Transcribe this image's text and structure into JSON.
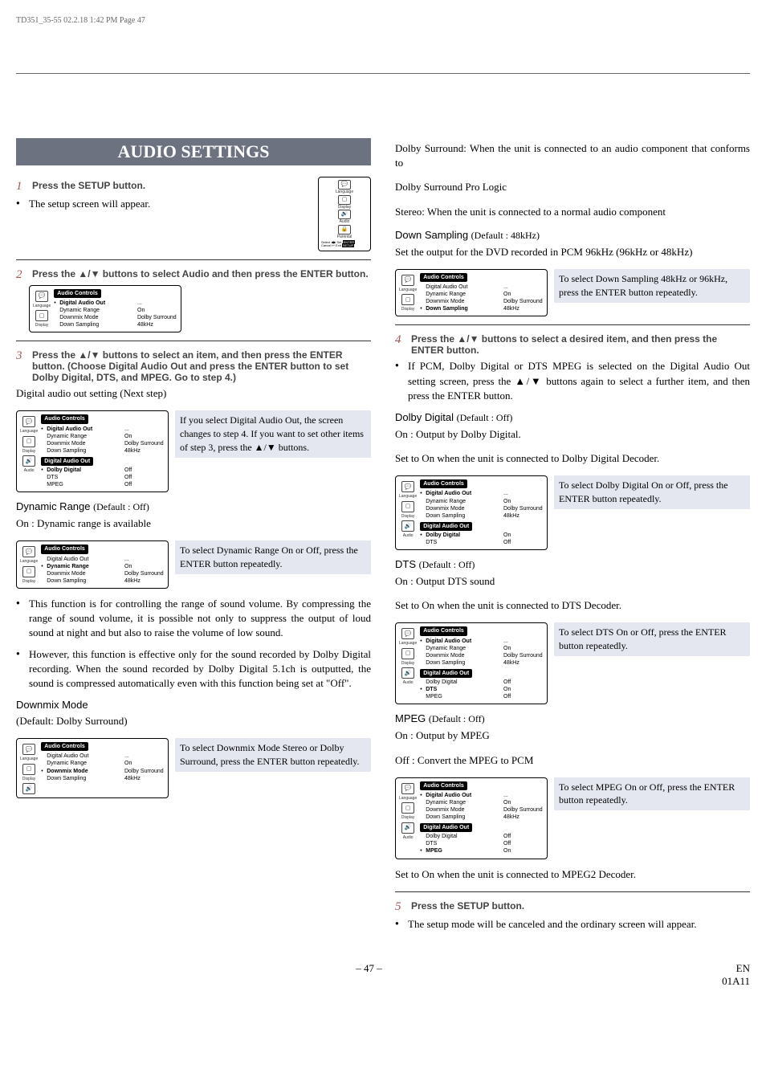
{
  "page_header": "TD351_35-55  02.2.18  1:42 PM  Page 47",
  "title": "AUDIO SETTINGS",
  "left": {
    "step1": {
      "num": "1",
      "text": "Press the SETUP button."
    },
    "step1_note": "The setup screen will appear.",
    "step2": {
      "num": "2",
      "text": "Press the ▲/▼ buttons to select Audio and then press the ENTER button."
    },
    "step3": {
      "num": "3",
      "text": "Press the ▲/▼ buttons to select an item, and then press the ENTER button. (Choose Digital Audio Out and press the ENTER button to set Dolby Digital, DTS, and MPEG. Go to step 4.)"
    },
    "digital_audio_head": "Digital audio out setting (Next step)",
    "digital_audio_caption": "If you select Digital Audio Out, the screen changes to step 4. If you want to set other items of step 3, press the ▲/▼ buttons.",
    "dynamic_head": "Dynamic Range",
    "dynamic_default": "(Default : Off)",
    "dynamic_sub": "On : Dynamic range is available",
    "dynamic_caption": "To select Dynamic Range On or Off, press the ENTER button repeatedly.",
    "dynamic_bul1": "This function is for controlling the range of sound volume. By compressing the range of sound volume, it is possible not only to suppress the output of loud sound at night and but also to raise the volume of low sound.",
    "dynamic_bul2": "However, this function is effective only for the sound recorded by Dolby Digital recording. When the sound recorded by Dolby Digital 5.1ch is outputted, the sound is compressed automatically even with this function being set at \"Off\".",
    "downmix_head": "Downmix Mode",
    "downmix_default": "(Default: Dolby Surround)",
    "downmix_caption": "To select Downmix Mode Stereo or Dolby Surround, press the ENTER button repeatedly."
  },
  "right": {
    "intro1": "Dolby Surround: When the unit is connected to an audio component that conforms to",
    "intro2": "Dolby Surround Pro Logic",
    "intro3": "Stereo: When the unit is connected to a normal audio component",
    "downsamp_head": "Down Sampling",
    "downsamp_default": "(Default : 48kHz)",
    "downsamp_text": "Set the output for the DVD recorded in PCM 96kHz (96kHz or 48kHz)",
    "downsamp_caption": "To select Down Sampling 48kHz or 96kHz, press the ENTER button repeatedly.",
    "step4": {
      "num": "4",
      "text": "Press the ▲/▼ buttons to select a desired item, and then press the ENTER button."
    },
    "step4_note": "If PCM, Dolby Digital or DTS MPEG is selected on the Digital Audio Out setting screen, press the ▲/▼ buttons again to select a further item, and then press the ENTER button.",
    "dolby_head": "Dolby Digital",
    "dolby_default": "(Default : Off)",
    "dolby_on": "On : Output by Dolby Digital.",
    "dolby_text": "Set to On when the unit is connected to Dolby Digital Decoder.",
    "dolby_caption": "To select Dolby Digital On or Off, press the ENTER button repeatedly.",
    "dts_head": "DTS",
    "dts_default": "(Default : Off)",
    "dts_on": "On : Output DTS sound",
    "dts_text": "Set to On when the unit is connected to DTS Decoder.",
    "dts_caption": "To select DTS On or Off, press the ENTER button repeatedly.",
    "mpeg_head": "MPEG",
    "mpeg_default": "(Default : Off)",
    "mpeg_on": "On : Output by MPEG",
    "mpeg_off": "Off : Convert the MPEG to PCM",
    "mpeg_caption": "To select MPEG On or Off, press the ENTER button repeatedly.",
    "mpeg_text": "Set to On when the unit is connected to MPEG2 Decoder.",
    "step5": {
      "num": "5",
      "text": "Press the SETUP button."
    },
    "step5_note": "The setup mode will be canceled and the ordinary screen will appear."
  },
  "menu": {
    "title": "Audio Controls",
    "dao_title": "Digital Audio Out",
    "rows": {
      "dao": {
        "label": "Digital Audio Out",
        "val": "..."
      },
      "dr": {
        "label": "Dynamic Range",
        "val": "On"
      },
      "dm": {
        "label": "Downmix Mode",
        "val": "Dolby Surround"
      },
      "ds": {
        "label": "Down Sampling",
        "val": "48kHz"
      },
      "dd_off": {
        "label": "Dolby Digital",
        "val": "Off"
      },
      "dd_on": {
        "label": "Dolby Digital",
        "val": "On"
      },
      "dts_off": {
        "label": "DTS",
        "val": "Off"
      },
      "dts_on": {
        "label": "DTS",
        "val": "On"
      },
      "mpeg_off": {
        "label": "MPEG",
        "val": "Off"
      },
      "mpeg_on": {
        "label": "MPEG",
        "val": "On"
      }
    },
    "side": {
      "language": "Language",
      "display": "Display",
      "audio": "Audio",
      "parental": "Parental"
    },
    "setupfoot": {
      "select": "Select",
      "set": "Set",
      "cancel": "Cancel",
      "exit": "Exit",
      "enter": "ENTER",
      "setup": "SETUP"
    }
  },
  "footer": {
    "page": "– 47 –",
    "code1": "EN",
    "code2": "01A11"
  }
}
